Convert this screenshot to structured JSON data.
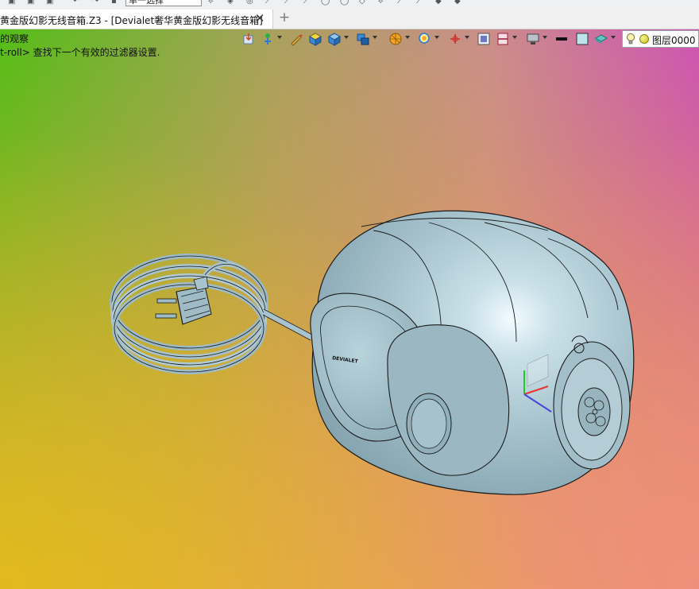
{
  "toolbar_top": {
    "select_mode_value": "单一选择"
  },
  "tabs": [
    {
      "label": "黄金版幻影无线音箱.Z3 - [Devialet奢华黄金版幻影无线音箱]",
      "active": true
    }
  ],
  "tab_close_glyph": "✕",
  "tab_add_glyph": "+",
  "prompt": {
    "line1": "的观察",
    "line2": "t-roll> 查找下一个有效的过滤器设置."
  },
  "layer": {
    "name": "图层0000"
  },
  "model": {
    "brand_label": "DEVIALET",
    "body_color": "#a9c6d1",
    "edge_color": "#1a1a1a"
  },
  "icons": [
    "import-icon",
    "move-icon",
    "pen-icon",
    "shaded-cube-icon",
    "cube-icon",
    "view-cube-icon",
    "render-icon",
    "zoom-icon",
    "axis-icon",
    "frame-icon",
    "section-icon",
    "display-icon",
    "line-color-icon",
    "fill-color-icon",
    "material-icon",
    "bulb-icon"
  ],
  "colors": {
    "accent_blue": "#2b7bd6",
    "toolbar_bg": "#eef0f3",
    "tab_bg": "#ffffff"
  }
}
